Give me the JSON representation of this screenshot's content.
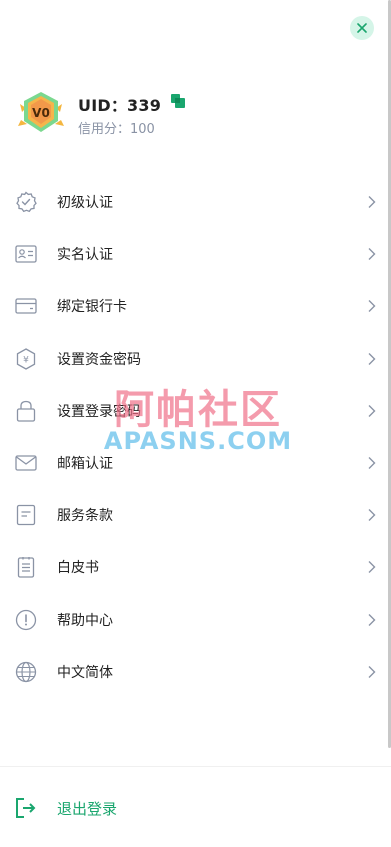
{
  "profile": {
    "level_badge": "V0",
    "uid": "UID：339",
    "credit": "信用分：100"
  },
  "menu": {
    "items": [
      {
        "label": "初级认证",
        "icon": "verified-badge-icon"
      },
      {
        "label": "实名认证",
        "icon": "id-card-icon"
      },
      {
        "label": "绑定银行卡",
        "icon": "bank-card-icon"
      },
      {
        "label": "设置资金密码",
        "icon": "yuan-shield-icon"
      },
      {
        "label": "设置登录密码",
        "icon": "lock-icon"
      },
      {
        "label": "邮箱认证",
        "icon": "mail-icon"
      },
      {
        "label": "服务条款",
        "icon": "document-icon"
      },
      {
        "label": "白皮书",
        "icon": "notebook-icon"
      },
      {
        "label": "帮助中心",
        "icon": "exclamation-circle-icon"
      },
      {
        "label": "中文简体",
        "icon": "globe-icon"
      }
    ]
  },
  "logout": {
    "label": "退出登录",
    "icon": "logout-icon"
  },
  "watermark": {
    "cn": "阿帕社区",
    "en": "APASNS.COM"
  },
  "colors": {
    "accent": "#1aa66e",
    "icon": "#8a93a5",
    "close_bg": "#d5f5e8",
    "close_x": "#1aa66e"
  }
}
